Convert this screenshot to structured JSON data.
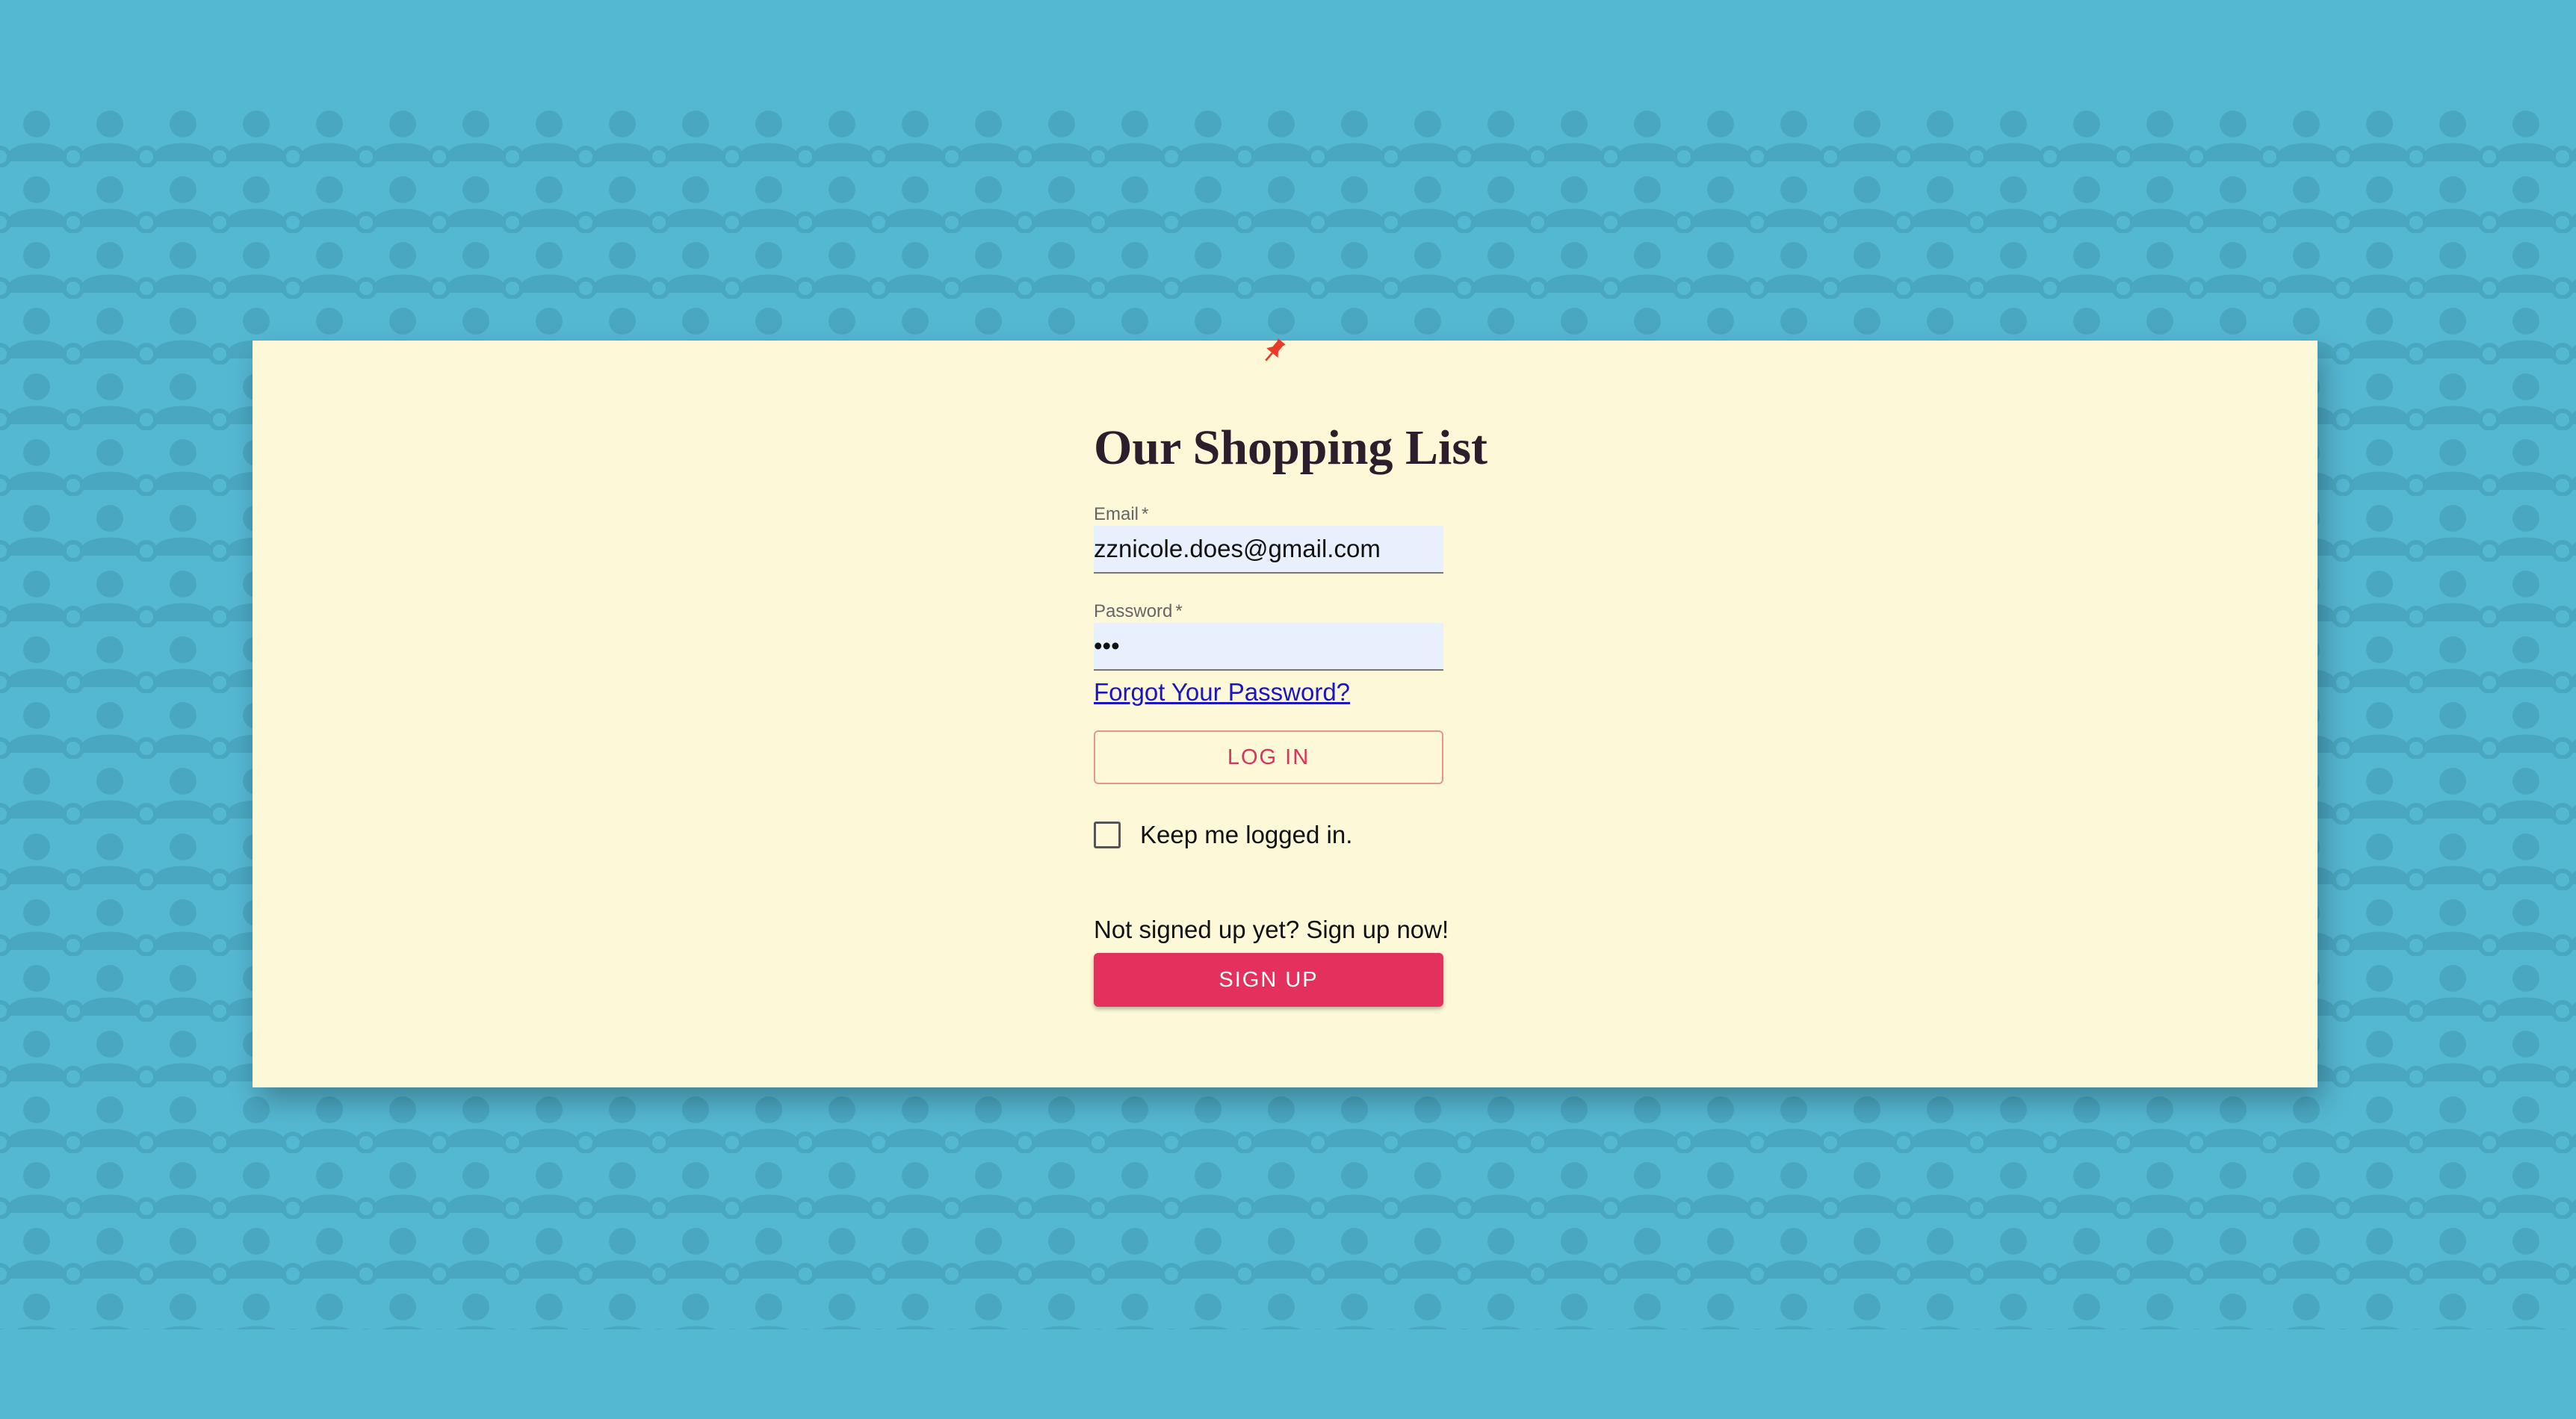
{
  "app": {
    "title": "Our Shopping List"
  },
  "login_form": {
    "email_label": "Email",
    "email_required_mark": "*",
    "email_value": "zznicole.does@gmail.com",
    "password_label": "Password",
    "password_required_mark": "*",
    "password_display": "•••",
    "forgot_password_link": "Forgot Your Password?",
    "login_button": "LOG IN",
    "keep_logged_in_label": "Keep me logged in.",
    "keep_logged_in_checked": false
  },
  "signup": {
    "prompt": "Not signed up yet? Sign up now!",
    "button": "SIGN UP"
  },
  "icons": {
    "pin": "pushpin-icon",
    "background": "person-icon-pattern"
  },
  "colors": {
    "background": "#55b8d3",
    "pattern": "#4aa7c2",
    "card": "#fdf9d8",
    "accent": "#e3305c",
    "link": "#1b14c8",
    "input_fill": "#e8f0fd",
    "title": "#2d1e2c"
  }
}
